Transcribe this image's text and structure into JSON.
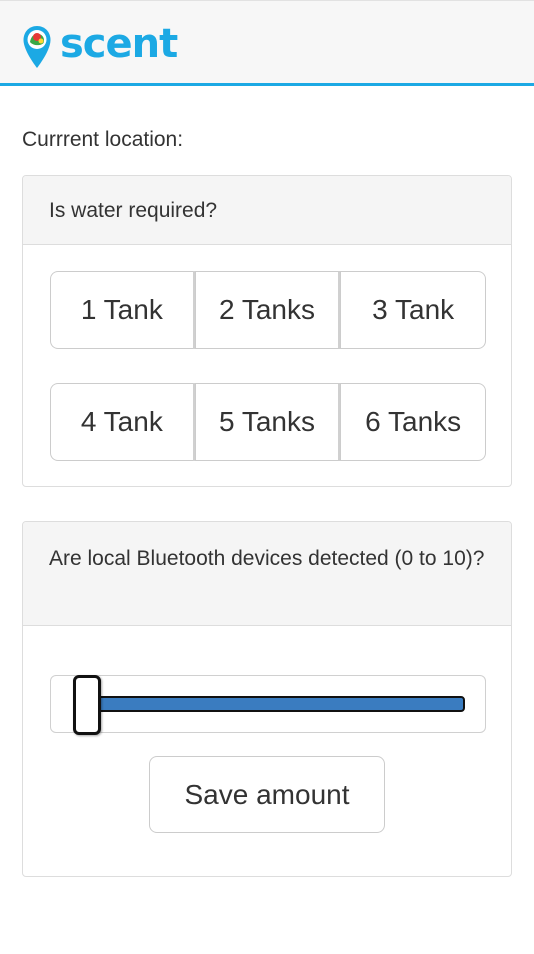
{
  "app": {
    "brand_name": "scent",
    "brand_color": "#1ca9e4",
    "logo_icon": "map-pin-icon"
  },
  "location": {
    "label": "Currrent location:"
  },
  "water_panel": {
    "question": "Is water required?",
    "options": [
      "1 Tank",
      "2 Tanks",
      "3 Tank",
      "4 Tank",
      "5 Tanks",
      "6 Tanks"
    ]
  },
  "bluetooth_panel": {
    "question": "Are local Bluetooth devices detected (0 to 10)?",
    "slider": {
      "min": 0,
      "max": 10,
      "value": 0,
      "fill_color": "#3a7cc0"
    },
    "save_label": "Save amount"
  }
}
